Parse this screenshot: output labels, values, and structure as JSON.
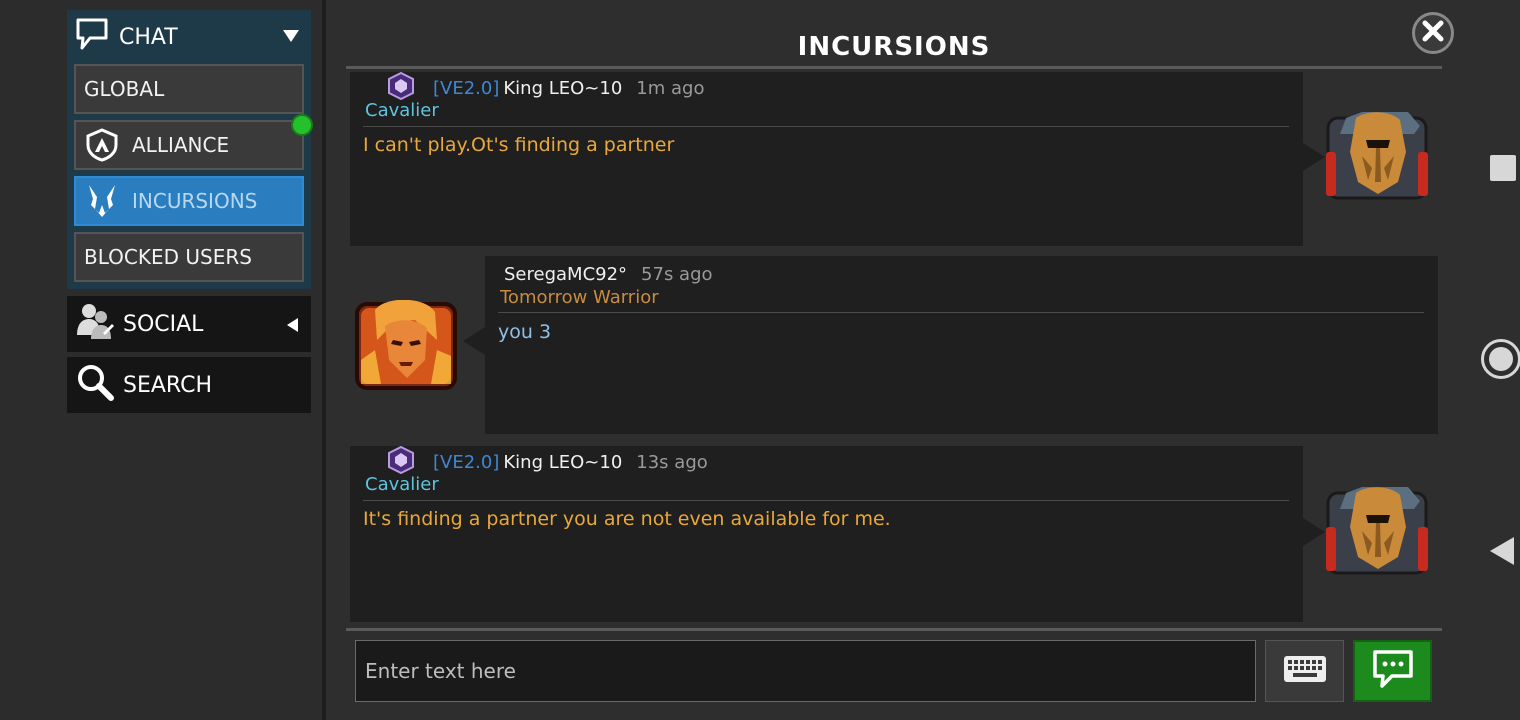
{
  "sidebar": {
    "chat_header": {
      "label": "CHAT",
      "icon": "speech-bubble-icon"
    },
    "chat_items": [
      {
        "label": "GLOBAL",
        "icon": ""
      },
      {
        "label": "ALLIANCE",
        "icon": "alliance-shield-icon",
        "online": true
      },
      {
        "label": "INCURSIONS",
        "icon": "incursions-icon",
        "active": true
      },
      {
        "label": "BLOCKED USERS",
        "icon": ""
      }
    ],
    "social": {
      "label": "SOCIAL",
      "icon": "social-users-icon"
    },
    "search": {
      "label": "SEARCH",
      "icon": "magnifier-icon"
    }
  },
  "main": {
    "title": "INCURSIONS"
  },
  "messages": [
    {
      "tag": "[VE2.0]",
      "username": "King LEO~10",
      "time": "1m ago",
      "rank": "Cavalier",
      "text": "I can't play.Ot's finding a partner",
      "side": "right"
    },
    {
      "tag": "",
      "username": "SeregaMC92°",
      "time": "57s ago",
      "rank": "Tomorrow Warrior",
      "text": "you 3",
      "side": "left"
    },
    {
      "tag": "[VE2.0]",
      "username": "King LEO~10",
      "time": "13s ago",
      "rank": "Cavalier",
      "text": "It's finding a partner you are not even available for me.",
      "side": "right"
    }
  ],
  "composer": {
    "placeholder": "Enter text here",
    "keyboard_icon": "keyboard-icon",
    "send_icon": "send-chat-icon"
  },
  "colors": {
    "accent_blue": "#2a7ec0",
    "chat_panel": "#1e3a48",
    "rank_cavalier": "#5fc4dc",
    "rank_tomorrow": "#c78c3e",
    "message_yellow": "#e9a83a",
    "message_blue": "#8fc1e6",
    "send_green": "#1c8a1c",
    "online_green": "#25c12c"
  }
}
